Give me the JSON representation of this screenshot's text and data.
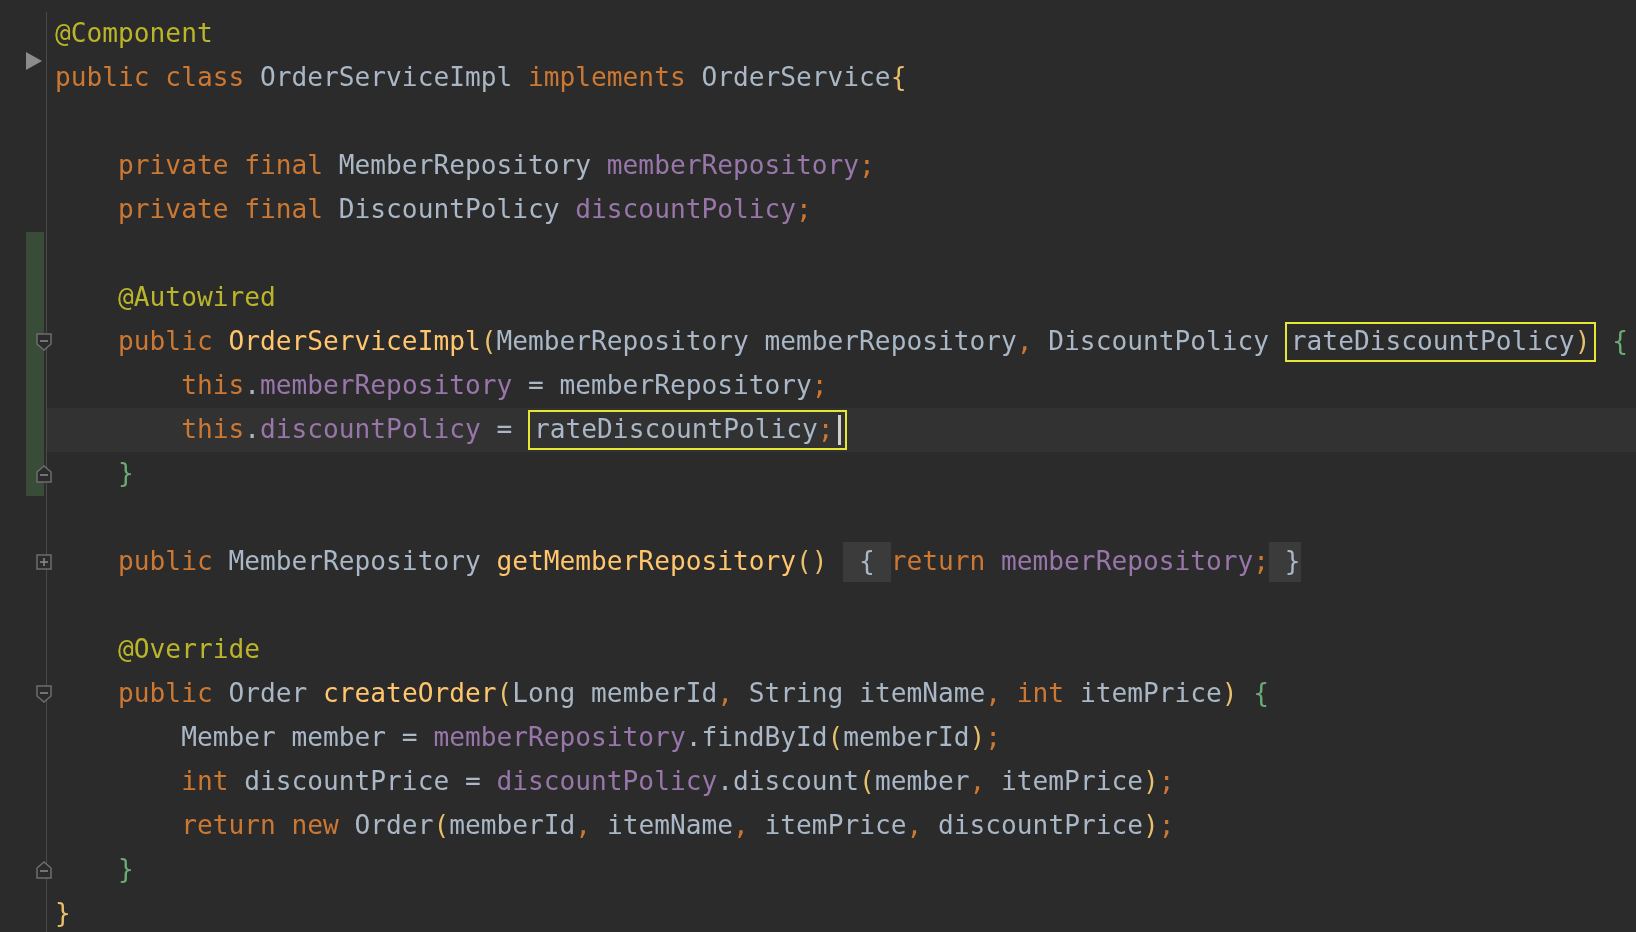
{
  "editor": {
    "lines": [
      {
        "changed": false,
        "current": false,
        "tokens": [
          {
            "text": "@Component",
            "kind": "annotation"
          }
        ]
      },
      {
        "gutter": {
          "kind": "run"
        },
        "changed": false,
        "current": false,
        "tokens": [
          {
            "text": "public class ",
            "kind": "keyword"
          },
          {
            "text": "OrderServiceImpl ",
            "kind": "plain"
          },
          {
            "text": "implements ",
            "kind": "keyword"
          },
          {
            "text": "OrderService",
            "kind": "plain"
          },
          {
            "text": "{",
            "kind": "bracket1"
          }
        ]
      },
      {
        "changed": false,
        "current": false
      },
      {
        "changed": false,
        "current": false,
        "tokens": [
          {
            "text": "    private final ",
            "kind": "keyword"
          },
          {
            "text": "MemberRepository ",
            "kind": "plain"
          },
          {
            "text": "memberRepository",
            "kind": "field"
          },
          {
            "text": ";",
            "kind": "keyword"
          }
        ]
      },
      {
        "changed": false,
        "current": false,
        "tokens": [
          {
            "text": "    private final ",
            "kind": "keyword"
          },
          {
            "text": "DiscountPolicy ",
            "kind": "plain"
          },
          {
            "text": "discountPolicy",
            "kind": "field"
          },
          {
            "text": ";",
            "kind": "keyword"
          }
        ]
      },
      {
        "changed": true,
        "current": false
      },
      {
        "changed": true,
        "current": false,
        "tokens": [
          {
            "text": "    @Autowired",
            "kind": "annotation"
          }
        ]
      },
      {
        "gutter": {
          "kind": "fold_open"
        },
        "changed": true,
        "current": false,
        "tokens": [
          {
            "text": "    public ",
            "kind": "keyword"
          },
          {
            "text": "OrderServiceImpl",
            "kind": "method"
          },
          {
            "text": "(",
            "kind": "bracket1"
          },
          {
            "text": "MemberRepository memberRepository",
            "kind": "plain"
          },
          {
            "text": ", ",
            "kind": "keyword"
          },
          {
            "text": "DiscountPolicy ",
            "kind": "plain"
          },
          {
            "kind": "box",
            "caret": false,
            "tokens": [
              {
                "text": "rateDiscountPolicy",
                "kind": "plain"
              },
              {
                "text": ")",
                "kind": "bracket1"
              }
            ]
          },
          {
            "text": " {",
            "kind": "bracket2"
          }
        ]
      },
      {
        "changed": true,
        "current": false,
        "tokens": [
          {
            "text": "        this",
            "kind": "keyword"
          },
          {
            "text": ".",
            "kind": "plain"
          },
          {
            "text": "memberRepository",
            "kind": "field"
          },
          {
            "text": " = memberRepository",
            "kind": "plain"
          },
          {
            "text": ";",
            "kind": "keyword"
          }
        ]
      },
      {
        "changed": true,
        "current": true,
        "tokens": [
          {
            "text": "        this",
            "kind": "keyword"
          },
          {
            "text": ".",
            "kind": "plain"
          },
          {
            "text": "discountPolicy",
            "kind": "field"
          },
          {
            "text": " = ",
            "kind": "plain"
          },
          {
            "kind": "box",
            "caret": true,
            "tokens": [
              {
                "text": "rateDiscountPolicy",
                "kind": "plain"
              },
              {
                "text": ";",
                "kind": "keyword"
              }
            ]
          }
        ]
      },
      {
        "gutter": {
          "kind": "fold_close"
        },
        "changed": true,
        "current": false,
        "tokens": [
          {
            "text": "    }",
            "kind": "bracket2"
          }
        ]
      },
      {
        "changed": false,
        "current": false
      },
      {
        "gutter": {
          "kind": "fold_collapsed"
        },
        "changed": false,
        "current": false,
        "tokens": [
          {
            "text": "    public ",
            "kind": "keyword"
          },
          {
            "text": "MemberRepository ",
            "kind": "plain"
          },
          {
            "text": "getMemberRepository",
            "kind": "method"
          },
          {
            "text": "() ",
            "kind": "bracket1"
          },
          {
            "text": " { ",
            "kind": "folded"
          },
          {
            "text": "return ",
            "kind": "keyword"
          },
          {
            "text": "memberRepository",
            "kind": "field"
          },
          {
            "text": ";",
            "kind": "keyword"
          },
          {
            "text": " }",
            "kind": "folded"
          }
        ]
      },
      {
        "changed": false,
        "current": false
      },
      {
        "changed": false,
        "current": false,
        "tokens": [
          {
            "text": "    @Override",
            "kind": "annotation"
          }
        ]
      },
      {
        "gutter": {
          "kind": "fold_open"
        },
        "changed": false,
        "current": false,
        "tokens": [
          {
            "text": "    public ",
            "kind": "keyword"
          },
          {
            "text": "Order ",
            "kind": "plain"
          },
          {
            "text": "createOrder",
            "kind": "method"
          },
          {
            "text": "(",
            "kind": "bracket1"
          },
          {
            "text": "Long memberId",
            "kind": "plain"
          },
          {
            "text": ", ",
            "kind": "keyword"
          },
          {
            "text": "String itemName",
            "kind": "plain"
          },
          {
            "text": ", ",
            "kind": "keyword"
          },
          {
            "text": "int ",
            "kind": "keyword"
          },
          {
            "text": "itemPrice",
            "kind": "plain"
          },
          {
            "text": ")",
            "kind": "bracket1"
          },
          {
            "text": " {",
            "kind": "bracket2"
          }
        ]
      },
      {
        "changed": false,
        "current": false,
        "tokens": [
          {
            "text": "        Member member = ",
            "kind": "plain"
          },
          {
            "text": "memberRepository",
            "kind": "field"
          },
          {
            "text": ".findById",
            "kind": "plain"
          },
          {
            "text": "(",
            "kind": "bracket1"
          },
          {
            "text": "memberId",
            "kind": "plain"
          },
          {
            "text": ")",
            "kind": "bracket1"
          },
          {
            "text": ";",
            "kind": "keyword"
          }
        ]
      },
      {
        "changed": false,
        "current": false,
        "tokens": [
          {
            "text": "        int ",
            "kind": "keyword"
          },
          {
            "text": "discountPrice = ",
            "kind": "plain"
          },
          {
            "text": "discountPolicy",
            "kind": "field"
          },
          {
            "text": ".discount",
            "kind": "plain"
          },
          {
            "text": "(",
            "kind": "bracket1"
          },
          {
            "text": "member",
            "kind": "plain"
          },
          {
            "text": ", ",
            "kind": "keyword"
          },
          {
            "text": "itemPrice",
            "kind": "plain"
          },
          {
            "text": ")",
            "kind": "bracket1"
          },
          {
            "text": ";",
            "kind": "keyword"
          }
        ]
      },
      {
        "changed": false,
        "current": false,
        "tokens": [
          {
            "text": "        return new ",
            "kind": "keyword"
          },
          {
            "text": "Order",
            "kind": "plain"
          },
          {
            "text": "(",
            "kind": "bracket1"
          },
          {
            "text": "memberId",
            "kind": "plain"
          },
          {
            "text": ", ",
            "kind": "keyword"
          },
          {
            "text": "itemName",
            "kind": "plain"
          },
          {
            "text": ", ",
            "kind": "keyword"
          },
          {
            "text": "itemPrice",
            "kind": "plain"
          },
          {
            "text": ", ",
            "kind": "keyword"
          },
          {
            "text": "discountPrice",
            "kind": "plain"
          },
          {
            "text": ")",
            "kind": "bracket1"
          },
          {
            "text": ";",
            "kind": "keyword"
          }
        ]
      },
      {
        "gutter": {
          "kind": "fold_close"
        },
        "changed": false,
        "current": false,
        "tokens": [
          {
            "text": "    }",
            "kind": "bracket2"
          }
        ]
      },
      {
        "changed": false,
        "current": false,
        "tokens": [
          {
            "text": "}",
            "kind": "bracket1"
          }
        ]
      }
    ]
  }
}
